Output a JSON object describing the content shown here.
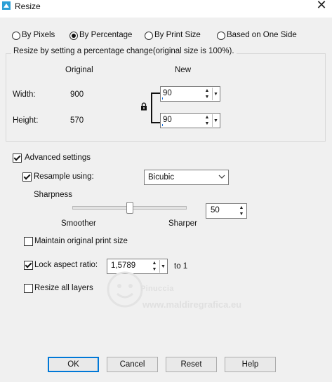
{
  "window": {
    "title": "Resize",
    "close_glyph": "✕"
  },
  "resize_mode": {
    "options": [
      {
        "label": "By Pixels",
        "selected": false
      },
      {
        "label": "By Percentage",
        "selected": true
      },
      {
        "label": "By Print Size",
        "selected": false
      },
      {
        "label": "Based on One Side",
        "selected": false
      }
    ]
  },
  "percent_group": {
    "caption": "Resize by setting a percentage change(original size is 100%).",
    "original_header": "Original",
    "new_header": "New",
    "width": {
      "label": "Width:",
      "original": "900",
      "new": "90"
    },
    "height": {
      "label": "Height:",
      "original": "570",
      "new": "90"
    },
    "lock_icon": "padlock-icon"
  },
  "advanced": {
    "label": "Advanced settings",
    "checked": true,
    "resample": {
      "label": "Resample using:",
      "checked": true,
      "method": "Bicubic"
    },
    "sharpness": {
      "label": "Sharpness",
      "value": "50",
      "min_label": "Smoother",
      "max_label": "Sharper",
      "level_percent": 50
    },
    "maintain_print_size": {
      "label": "Maintain original print size",
      "checked": false
    },
    "lock_aspect": {
      "label": "Lock aspect ratio:",
      "checked": true,
      "value": "1,5789",
      "suffix": "to 1"
    },
    "resize_all_layers": {
      "label": "Resize all layers",
      "checked": false
    }
  },
  "buttons": {
    "ok": "OK",
    "cancel": "Cancel",
    "reset": "Reset",
    "help": "Help"
  },
  "watermark": {
    "line1": "Pinuccia",
    "line2": "www.maldiregrafica.eu"
  },
  "colors": {
    "accent": "#0078d7",
    "dialog_bg": "#f0f0f0",
    "app_icon": "#2a9fd6"
  }
}
